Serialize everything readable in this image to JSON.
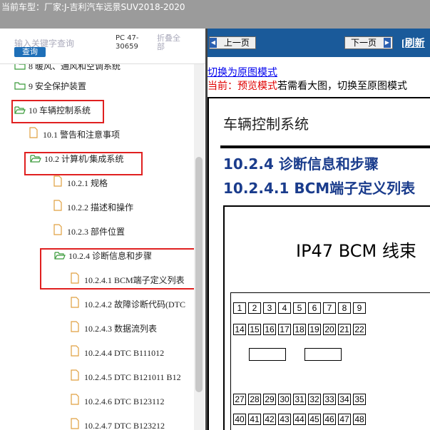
{
  "topbar": {
    "title": "当前车型：厂家:J-吉利汽车远景SUV2018-2020"
  },
  "search": {
    "placeholder": "输入关键字查询",
    "button": "查询",
    "pc": "PC 47-30659",
    "fold": "折叠全部"
  },
  "tree": [
    {
      "label": "8 暖风、通风和空调系统",
      "type": "folder"
    },
    {
      "label": "9 安全保护装置",
      "type": "folder"
    },
    {
      "label": "10 车辆控制系统",
      "type": "folder-open"
    },
    {
      "label": "10.1 警告和注意事项",
      "type": "doc"
    },
    {
      "label": "10.2 计算机/集成系统",
      "type": "folder-open"
    },
    {
      "label": "10.2.1 规格",
      "type": "doc"
    },
    {
      "label": "10.2.2 描述和操作",
      "type": "doc"
    },
    {
      "label": "10.2.3 部件位置",
      "type": "doc"
    },
    {
      "label": "10.2.4 诊断信息和步骤",
      "type": "folder-open"
    },
    {
      "label": "10.2.4.1 BCM端子定义列表",
      "type": "doc"
    },
    {
      "label": "10.2.4.2 故障诊断代码(DTC",
      "type": "doc"
    },
    {
      "label": "10.2.4.3 数据流列表",
      "type": "doc"
    },
    {
      "label": "10.2.4.4 DTC B111012",
      "type": "doc"
    },
    {
      "label": "10.2.4.5 DTC B121011 B12",
      "type": "doc"
    },
    {
      "label": "10.2.4.6 DTC B123112",
      "type": "doc"
    },
    {
      "label": "10.2.4.7 DTC B123212",
      "type": "doc"
    }
  ],
  "nav": {
    "prev": "上一页",
    "next": "下一页",
    "refresh": "[刷新"
  },
  "mode": {
    "switch_link": "切换为原图模式",
    "current_prefix": "当前：预览模式",
    "current_suffix": "若需看大图，切换至原图模式"
  },
  "doc": {
    "heading": "车辆控制系统",
    "section": "10.2.4 诊断信息和步骤",
    "subsection": "10.2.4.1 BCM端子定义列表",
    "diagram_caption": "IP47   BCM 线束",
    "row1": [
      "1",
      "2",
      "3",
      "4",
      "5",
      "6",
      "7",
      "8",
      "9"
    ],
    "row2": [
      "14",
      "15",
      "16",
      "17",
      "18",
      "19",
      "20",
      "21",
      "22"
    ],
    "row3": [
      "27",
      "28",
      "29",
      "30",
      "31",
      "32",
      "33",
      "34",
      "35"
    ],
    "row4": [
      "40",
      "41",
      "42",
      "43",
      "44",
      "45",
      "46",
      "47",
      "48"
    ]
  },
  "colors": {
    "accent": "#1a5a9a",
    "highlight": "#e02020",
    "topbar": "#9b9b9b"
  }
}
